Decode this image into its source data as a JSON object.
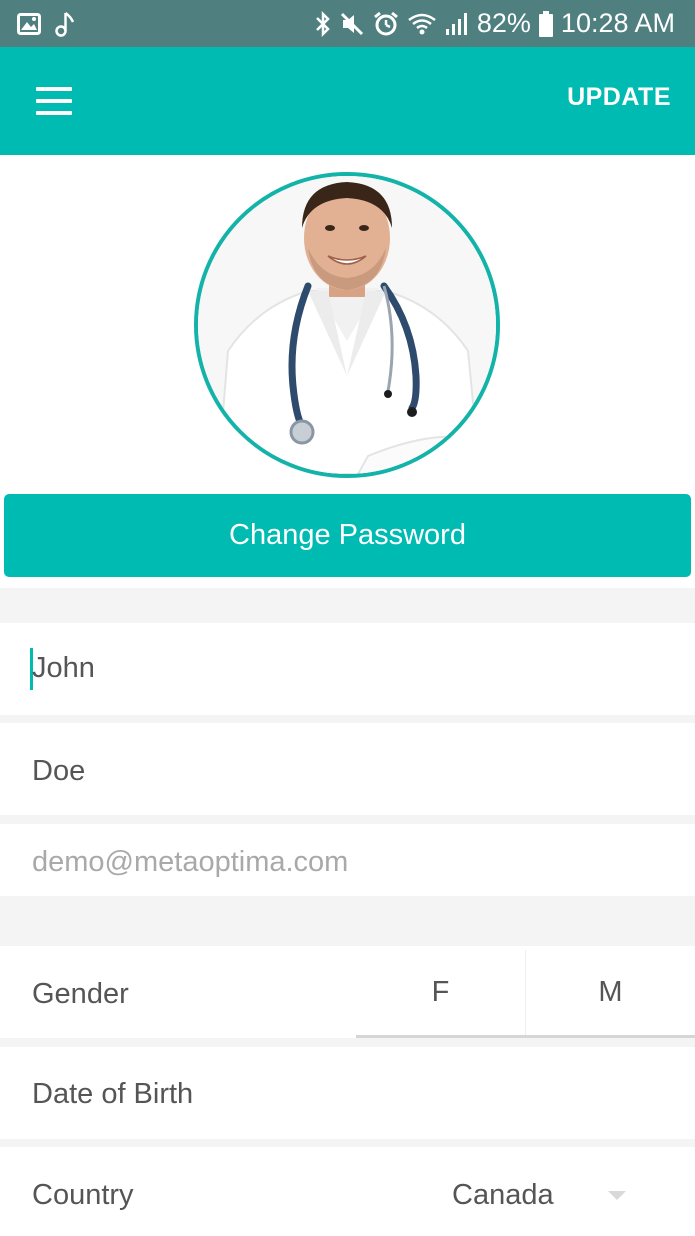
{
  "status_bar": {
    "battery": "82%",
    "time": "10:28 AM",
    "icons": [
      "image-icon",
      "music-note-icon",
      "bluetooth-icon",
      "mute-icon",
      "alarm-icon",
      "wifi-icon",
      "signal-icon",
      "battery-icon"
    ]
  },
  "app_bar": {
    "menu_icon": "hamburger-menu-icon",
    "update_label": "UPDATE"
  },
  "profile": {
    "change_password_label": "Change Password"
  },
  "form": {
    "first_name": "John",
    "last_name": "Doe",
    "email_placeholder": "demo@metaoptima.com",
    "gender_label": "Gender",
    "gender_options": [
      "F",
      "M"
    ],
    "dob_label": "Date of Birth",
    "country_label": "Country",
    "country_value": "Canada"
  },
  "colors": {
    "accent": "#00bbb2",
    "status_bar": "#4f7f7f",
    "background": "#f4f4f4"
  }
}
